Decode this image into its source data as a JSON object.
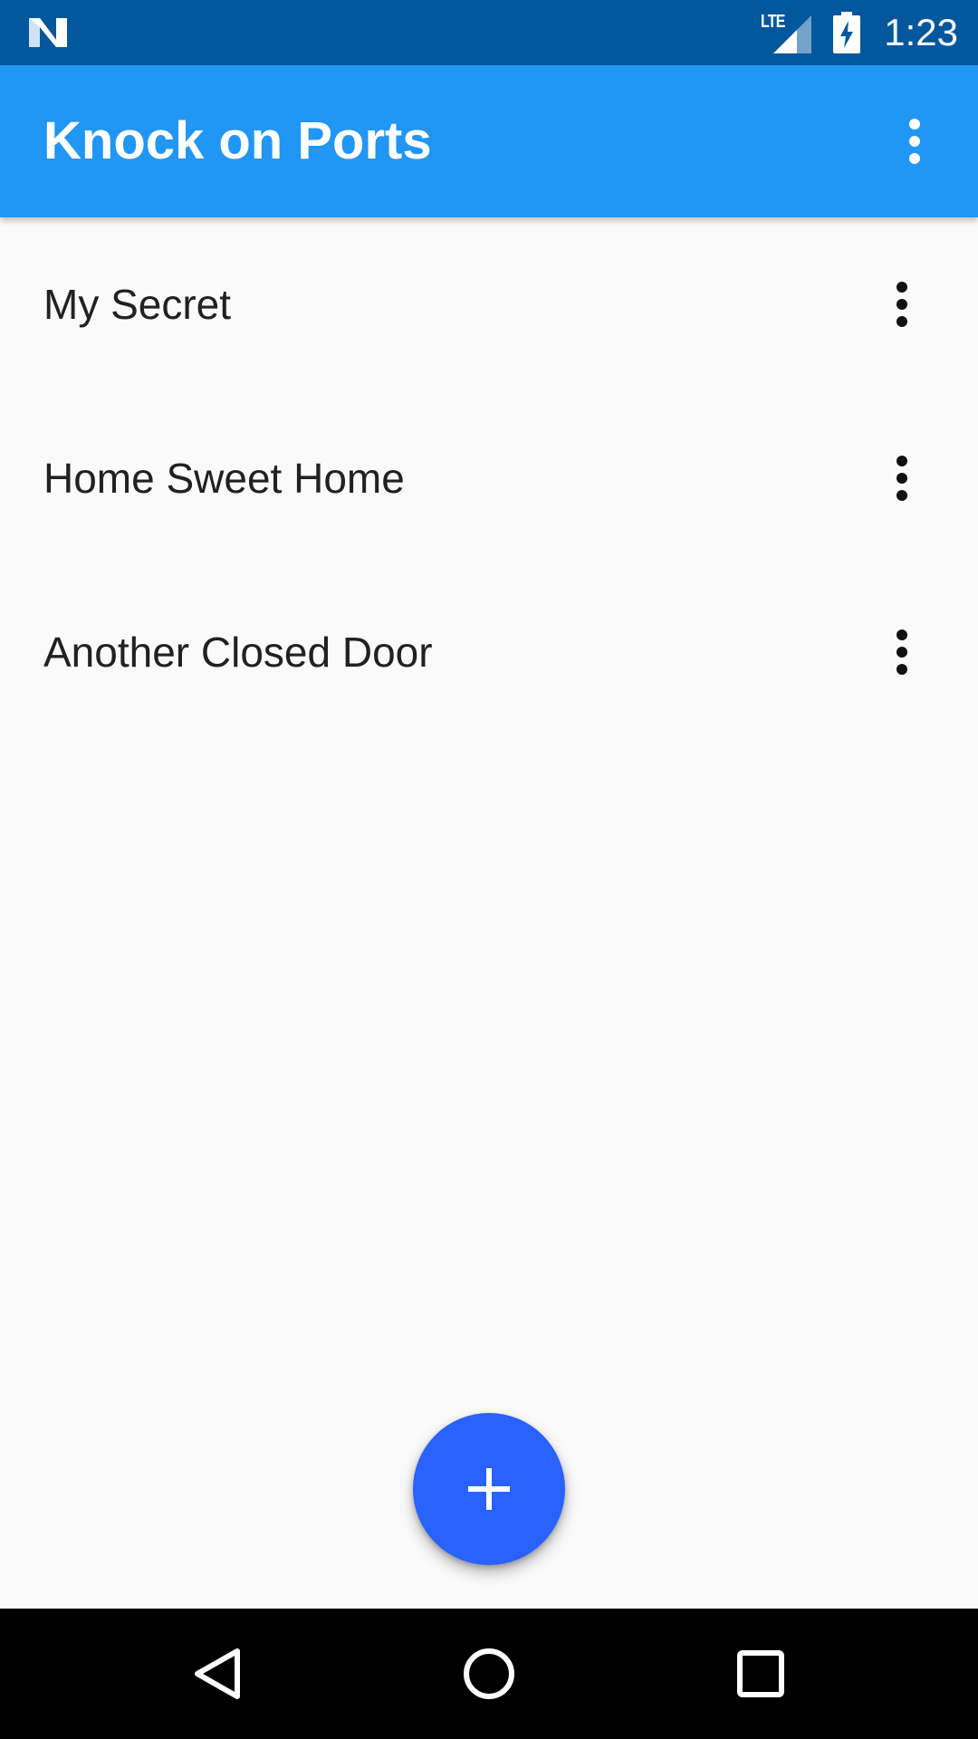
{
  "status_bar": {
    "network_label": "LTE",
    "time": "1:23",
    "icons": [
      "notification-n-icon",
      "signal-icon",
      "battery-charging-icon"
    ]
  },
  "app_bar": {
    "title": "Knock on Ports",
    "menu_icon": "more-vert-icon"
  },
  "list": {
    "items": [
      {
        "label": "My Secret"
      },
      {
        "label": "Home Sweet Home"
      },
      {
        "label": "Another Closed Door"
      }
    ],
    "item_menu_icon": "more-vert-icon"
  },
  "fab": {
    "icon": "add-icon"
  },
  "nav_bar": {
    "icons": [
      "back-icon",
      "home-icon",
      "recents-icon"
    ]
  },
  "colors": {
    "status_bar": "#03579c",
    "app_bar": "#2196f3",
    "fab": "#2962ff",
    "background": "#fafafa",
    "nav_bar": "#000000"
  }
}
